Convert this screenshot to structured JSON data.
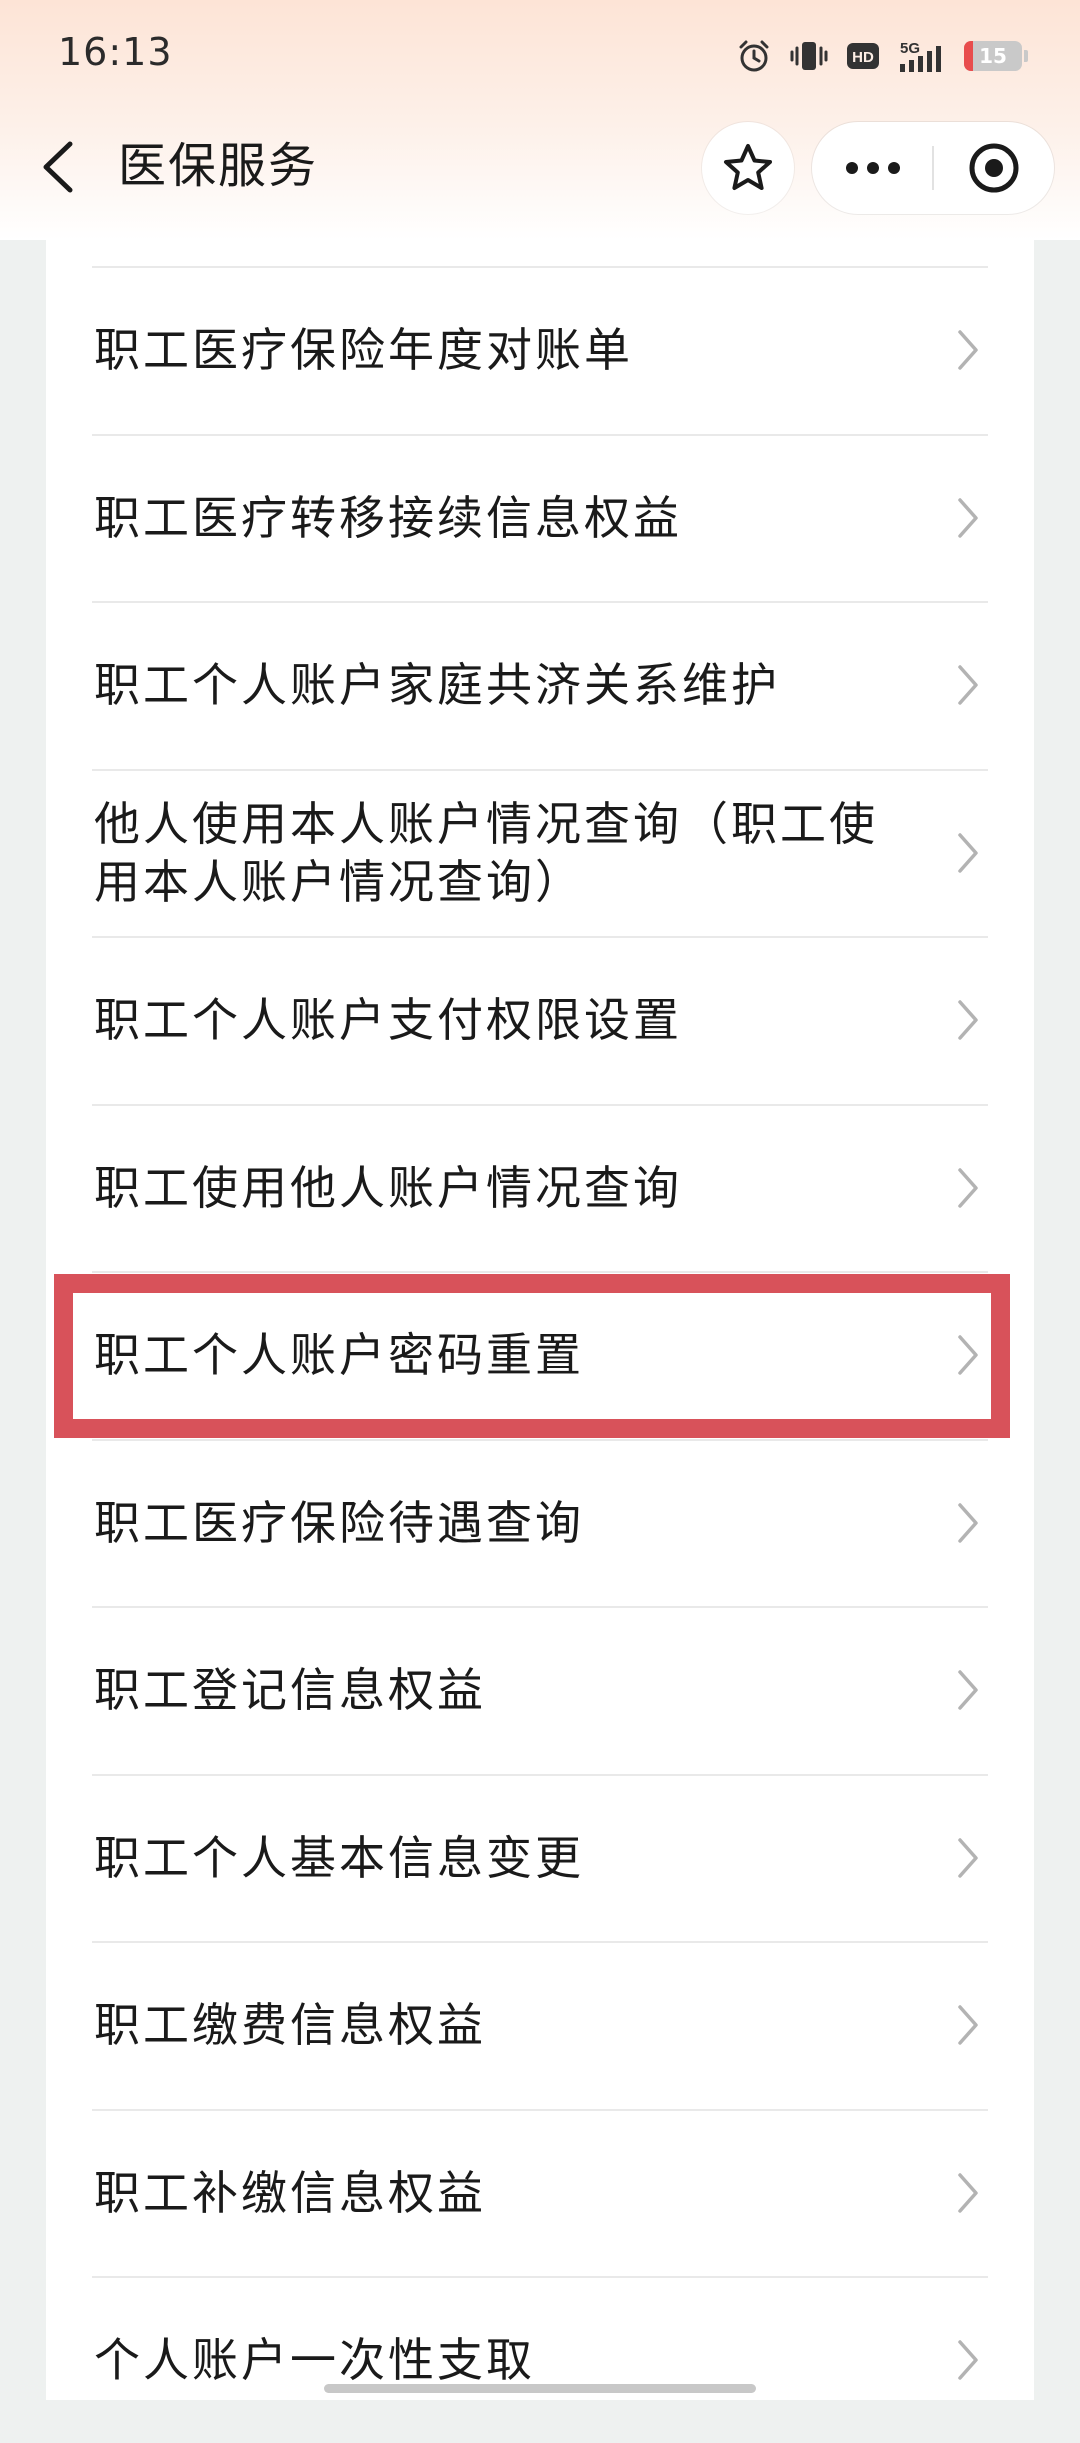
{
  "status_bar": {
    "time": "16:13",
    "network": "5G",
    "hd": "HD",
    "battery_level": "15",
    "battery_fraction": 0.15,
    "icons": [
      "alarm-icon",
      "vibrate-icon",
      "hd-icon",
      "signal-5g-icon",
      "battery-icon"
    ]
  },
  "header": {
    "title": "医保服务",
    "back_icon": "back-chevron-icon",
    "favorite_icon": "star-icon",
    "more_icon": "more-dots-icon",
    "close_icon": "close-target-icon"
  },
  "list": {
    "items": [
      {
        "label": "职工医疗保险年度对账单"
      },
      {
        "label": "职工医疗转移接续信息权益"
      },
      {
        "label": "职工个人账户家庭共济关系维护"
      },
      {
        "label": "他人使用本人账户情况查询（职工使用本人账户情况查询）"
      },
      {
        "label": "职工个人账户支付权限设置"
      },
      {
        "label": "职工使用他人账户情况查询"
      },
      {
        "label": "职工个人账户密码重置"
      },
      {
        "label": "职工医疗保险待遇查询"
      },
      {
        "label": "职工登记信息权益"
      },
      {
        "label": "职工个人基本信息变更"
      },
      {
        "label": "职工缴费信息权益"
      },
      {
        "label": "职工补缴信息权益"
      },
      {
        "label": "个人账户一次性支取"
      }
    ],
    "highlighted_index": 6
  },
  "colors": {
    "highlight_border": "#d8525a",
    "page_background": "#eef1f0",
    "card_background": "#ffffff",
    "text": "#1a1a1a",
    "chevron": "#b3b3b3"
  }
}
